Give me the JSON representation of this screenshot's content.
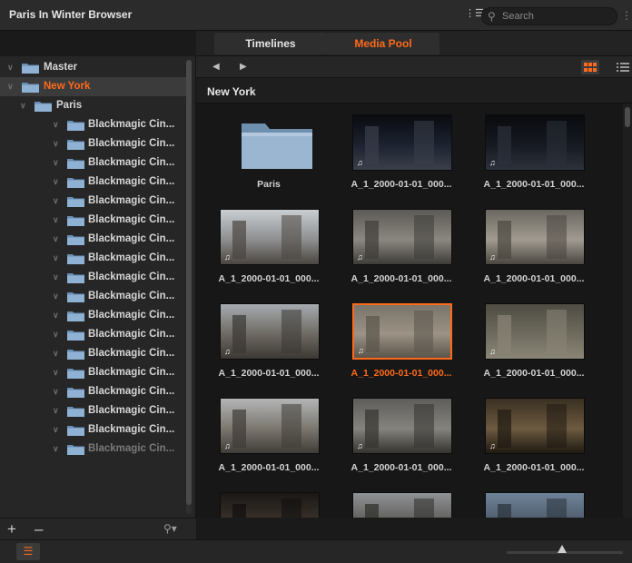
{
  "window": {
    "title": "Paris In Winter Browser"
  },
  "search": {
    "placeholder": "Search"
  },
  "tabs": [
    {
      "label": "Timelines"
    },
    {
      "label": "Media Pool",
      "active": true
    }
  ],
  "path": {
    "current": "New York"
  },
  "tree": {
    "master": "Master",
    "new_york": "New York",
    "paris": "Paris",
    "clips": [
      "Blackmagic Cin...",
      "Blackmagic Cin...",
      "Blackmagic Cin...",
      "Blackmagic Cin...",
      "Blackmagic Cin...",
      "Blackmagic Cin...",
      "Blackmagic Cin...",
      "Blackmagic Cin...",
      "Blackmagic Cin...",
      "Blackmagic Cin...",
      "Blackmagic Cin...",
      "Blackmagic Cin...",
      "Blackmagic Cin...",
      "Blackmagic Cin...",
      "Blackmagic Cin...",
      "Blackmagic Cin...",
      "Blackmagic Cin...",
      "Blackmagic Cin..."
    ]
  },
  "media": [
    {
      "name": "Paris",
      "kind": "folder"
    },
    {
      "name": "A_1_2000-01-01_000...",
      "kind": "clip"
    },
    {
      "name": "A_1_2000-01-01_000...",
      "kind": "clip"
    },
    {
      "name": "A_1_2000-01-01_000...",
      "kind": "clip"
    },
    {
      "name": "A_1_2000-01-01_000...",
      "kind": "clip"
    },
    {
      "name": "A_1_2000-01-01_000...",
      "kind": "clip"
    },
    {
      "name": "A_1_2000-01-01_000...",
      "kind": "clip"
    },
    {
      "name": "A_1_2000-01-01_000...",
      "kind": "clip",
      "selected": true
    },
    {
      "name": "A_1_2000-01-01_000...",
      "kind": "clip"
    },
    {
      "name": "A_1_2000-01-01_000...",
      "kind": "clip"
    },
    {
      "name": "A_1_2000-01-01_000...",
      "kind": "clip"
    },
    {
      "name": "A_1_2000-01-01_000...",
      "kind": "clip"
    },
    {
      "name": "",
      "kind": "clip"
    },
    {
      "name": "",
      "kind": "clip"
    },
    {
      "name": "",
      "kind": "clip"
    }
  ],
  "colors": {
    "accent": "#ff6a1a",
    "background": "#1a1a1a",
    "panel": "#262627"
  },
  "zoom": {
    "value": 0.48
  }
}
